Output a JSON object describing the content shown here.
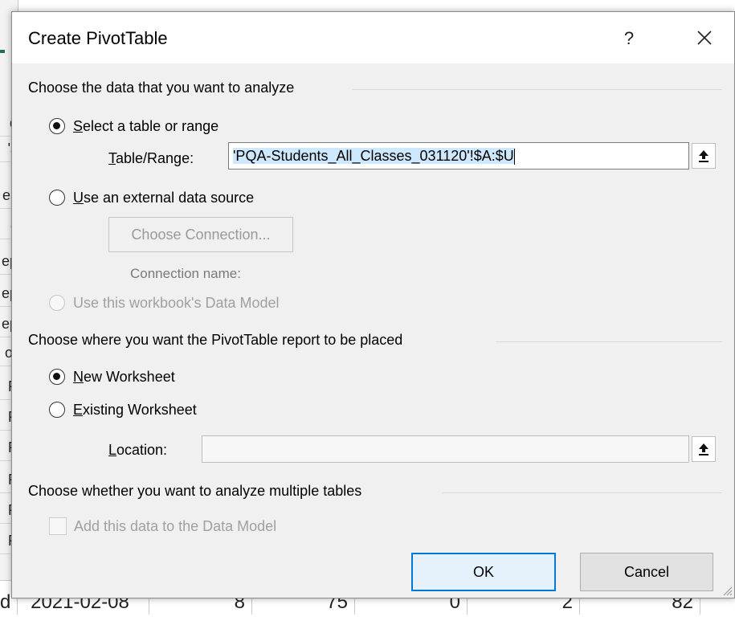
{
  "background": {
    "left_cells": [
      "d",
      "'s",
      "es",
      "c",
      "ep",
      "ep",
      "ep",
      "or",
      "P",
      "P",
      "P",
      "P",
      "P",
      "P"
    ],
    "bottom_row": {
      "first": "d",
      "date": "2021-02-08",
      "v1": "8",
      "v2": "75",
      "v3": "0",
      "v4": "2",
      "v5": "82"
    }
  },
  "dialog": {
    "title": "Create PivotTable",
    "help_label": "?",
    "close_icon": "close-icon"
  },
  "section1": {
    "header": "Choose the data that you want to analyze",
    "select_table": {
      "mnemonic": "S",
      "rest": "elect a table or range",
      "checked": true
    },
    "table_range": {
      "label_mnemonic": "T",
      "label_rest": "able/Range:",
      "value_selected": "'PQA-Students_All_Classes_031120'!$A:$U"
    },
    "external_source": {
      "mnemonic": "U",
      "rest": "se an external data source",
      "checked": false
    },
    "choose_connection_label": "Choose Connection...",
    "connection_name_label": "Connection name:",
    "data_model_option": {
      "label": "Use this workbook's Data Model",
      "disabled": true
    }
  },
  "section2": {
    "header": "Choose where you want the PivotTable report to be placed",
    "new_worksheet": {
      "mnemonic": "N",
      "rest": "ew Worksheet",
      "checked": true
    },
    "existing_worksheet": {
      "mnemonic": "E",
      "rest": "xisting Worksheet",
      "checked": false
    },
    "location": {
      "label_mnemonic": "L",
      "label_rest": "ocation:",
      "value": ""
    }
  },
  "section3": {
    "header": "Choose whether you want to analyze multiple tables",
    "add_to_data_model": {
      "label": "Add this data to the Data Model",
      "checked": false,
      "disabled": true
    }
  },
  "buttons": {
    "ok": "OK",
    "cancel": "Cancel"
  },
  "colors": {
    "accent": "#0078d7",
    "dialog_bg": "#f0f0f0",
    "selection": "#cde8ff",
    "excel_green": "#217346"
  }
}
